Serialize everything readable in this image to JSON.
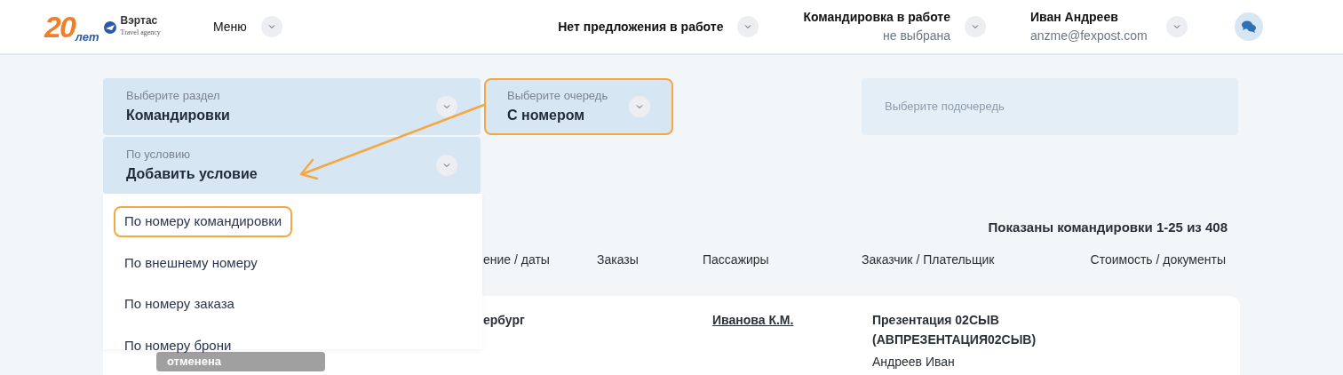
{
  "header": {
    "logo": {
      "years": "20",
      "years_word": "лет",
      "brand": "Вэртас",
      "tagline": "Travel agency"
    },
    "menu": {
      "label": "Меню"
    },
    "offer": {
      "label": "Нет предложения в работе"
    },
    "trip": {
      "label": "Командировка в работе",
      "value": "не выбрана"
    },
    "user": {
      "name": "Иван Андреев",
      "email": "anzme@fexpost.com"
    }
  },
  "filters": [
    {
      "label": "Выберите раздел",
      "value": "Командировки",
      "disabled": false,
      "highlighted": false
    },
    {
      "label": "Выберите очередь",
      "value": "С номером",
      "disabled": false,
      "highlighted": true
    },
    {
      "label": "Выберите подочередь",
      "disabled": true,
      "highlighted": false
    },
    {
      "label": "По условию",
      "value": "Добавить условие",
      "disabled": false,
      "highlighted": false,
      "expanded": true
    }
  ],
  "condition_menu": [
    {
      "label": "По номеру командировки",
      "highlighted": true
    },
    {
      "label": "По внешнему номеру",
      "highlighted": false
    },
    {
      "label": "По номеру заказа",
      "highlighted": false
    },
    {
      "label": "По номеру брони",
      "highlighted": false
    }
  ],
  "summary": "Показаны командировки 1-25 из 408",
  "table": {
    "columns": [
      "ение / даты",
      "Заказы",
      "Пассажиры",
      "Заказчик / Плательщик",
      "Стоимость / документы"
    ],
    "rows": [
      {
        "status": "отменена",
        "route": "ербург",
        "passenger": "Иванова К.М.",
        "customer": "Презентация 02СЫВ (АВПРЕЗЕНТАЦИЯ02СЫВ)",
        "payer": "Андреев Иван"
      }
    ]
  }
}
